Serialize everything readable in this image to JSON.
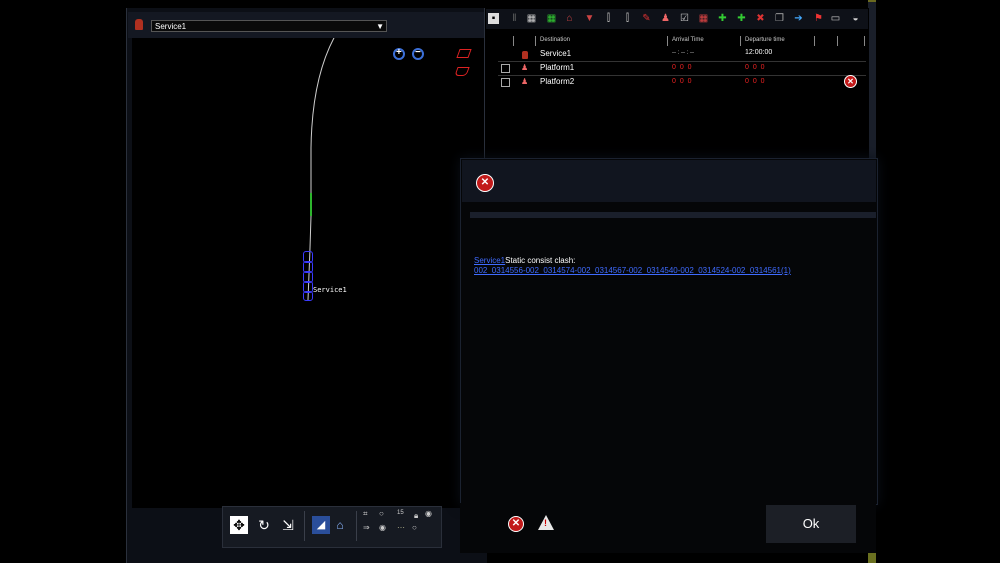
{
  "map": {
    "selected_service": "Service1",
    "service_marker_label": "Service1"
  },
  "map_toolbar": {
    "zoom_value": "15"
  },
  "timetable": {
    "columns": [
      "Destination",
      "Arrival Time",
      "Departure time"
    ],
    "rows": [
      {
        "destination": "Service1",
        "arrival": "-- : -- : --",
        "departure": "12:00:00"
      },
      {
        "destination": "Platform1",
        "arrival": "0 0 0",
        "departure": "0 0 0"
      },
      {
        "destination": "Platform2",
        "arrival": "0 0 0",
        "departure": "0 0 0"
      }
    ]
  },
  "dialog": {
    "link_service": "Service1",
    "message": "Static consist clash:",
    "detail": "002_0314556-002_0314574-002_0314567-002_0314540-002_0314524-002_0314561(1)",
    "ok_label": "Ok"
  },
  "colors": {
    "link": "#3f6bff",
    "error": "#c21a1a",
    "track": "#cfcfcf",
    "train": "#2a2ad8"
  }
}
